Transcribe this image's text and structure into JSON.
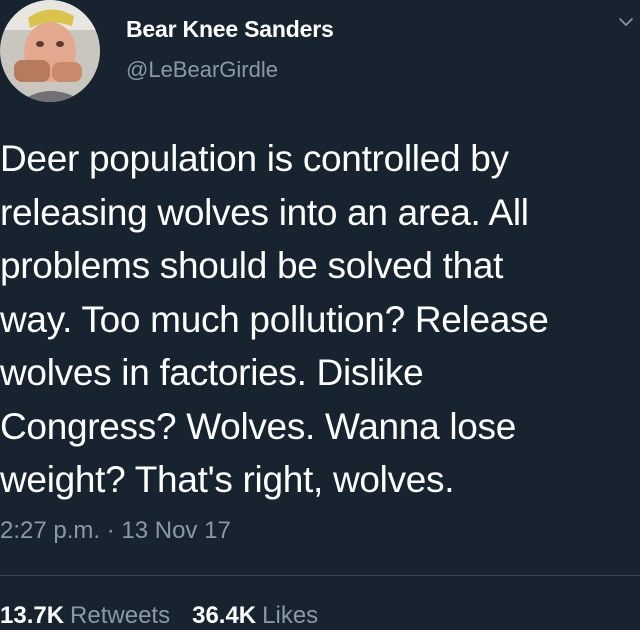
{
  "tweet": {
    "author": {
      "display_name": "Bear Knee Sanders",
      "handle": "@LeBearGirdle",
      "avatar_icon": "profile-photo"
    },
    "menu_icon": "chevron-down-icon",
    "text_lines": [
      "Deer population is controlled by",
      "releasing wolves into an area. All",
      "problems should be solved that",
      "way. Too much pollution? Release",
      "wolves in factories. Dislike",
      "Congress? Wolves. Wanna lose",
      "weight? That's right, wolves."
    ],
    "timestamp": "2:27 p.m. · 13 Nov 17",
    "stats": {
      "retweets_count": "13.7K",
      "retweets_label": "Retweets",
      "likes_count": "36.4K",
      "likes_label": "Likes"
    }
  },
  "colors": {
    "background": "#172430",
    "text": "#ffffff",
    "secondary_text": "#8899a6",
    "divider": "#38444d"
  }
}
